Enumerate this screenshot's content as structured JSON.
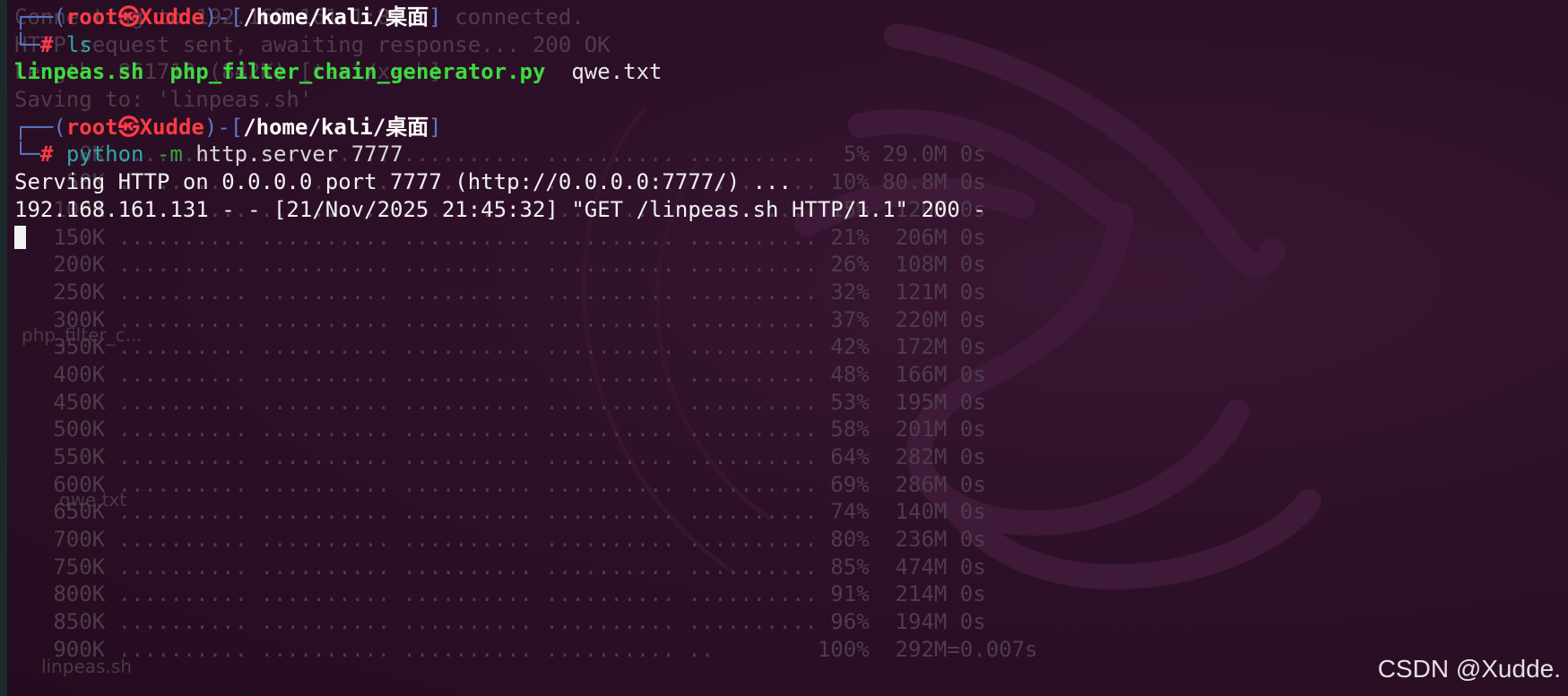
{
  "terminal": {
    "ghost_lines": [
      "Connecting to 192.168.161.1:80... connected.",
      "HTTP request sent, awaiting response... 200 OK",
      "Length: 861710 (842K) [text/x-sh]",
      "Saving to: 'linpeas.sh'",
      "",
      "     0K .......... .......... .......... .......... ..........  5% 29.0M 0s",
      "    50K .......... .......... .......... .......... .......... 10% 80.8M 0s",
      "   100K .......... .......... .......... .......... .......... 15% 1120M 0s",
      "   150K .......... .......... .......... .......... .......... 21%  206M 0s",
      "   200K .......... .......... .......... .......... .......... 26%  108M 0s",
      "   250K .......... .......... .......... .......... .......... 32%  121M 0s",
      "   300K .......... .......... .......... .......... .......... 37%  220M 0s",
      "   350K .......... .......... .......... .......... .......... 42%  172M 0s",
      "   400K .......... .......... .......... .......... .......... 48%  166M 0s",
      "   450K .......... .......... .......... .......... .......... 53%  195M 0s",
      "   500K .......... .......... .......... .......... .......... 58%  201M 0s",
      "   550K .......... .......... .......... .......... .......... 64%  282M 0s",
      "   600K .......... .......... .......... .......... .......... 69%  286M 0s",
      "   650K .......... .......... .......... .......... .......... 74%  140M 0s",
      "   700K .......... .......... .......... .......... .......... 80%  236M 0s",
      "   750K .......... .......... .......... .......... .......... 85%  474M 0s",
      "   800K .......... .......... .......... .......... .......... 91%  214M 0s",
      "   850K .......... .......... .......... .......... .......... 96%  194M 0s",
      "   900K .......... .......... .......... .......... ..        100%  292M=0.007s"
    ],
    "prompt1": {
      "box_top": "┌──(",
      "user": "root㉿Xudde",
      "sep": ")-[",
      "path": "/home/kali/桌面",
      "close": "]",
      "box_bottom": "└─",
      "hash": "#",
      "command": "ls"
    },
    "ls_output": {
      "file1": "linpeas.sh",
      "file2": "php_filter_chain_generator.py",
      "file3": "qwe.txt"
    },
    "prompt2": {
      "box_top": "┌──(",
      "user": "root㉿Xudde",
      "sep": ")-[",
      "path": "/home/kali/桌面",
      "close": "]",
      "box_bottom": "└─",
      "hash": "#",
      "cmd": "python",
      "flag": "-m",
      "args": "http.server 7777"
    },
    "server_output": [
      "Serving HTTP on 0.0.0.0 port 7777 (http://0.0.0.0:7777/) ...",
      "192.168.161.131 - - [21/Nov/2025 21:45:32] \"GET /linpeas.sh HTTP/1.1\" 200 -"
    ]
  },
  "desktop_ghost_labels": {
    "php_label": "php_filter_c...",
    "txt_label": "qwe.txt",
    "sh_label": "linpeas.sh"
  },
  "watermark": "CSDN @Xudde."
}
